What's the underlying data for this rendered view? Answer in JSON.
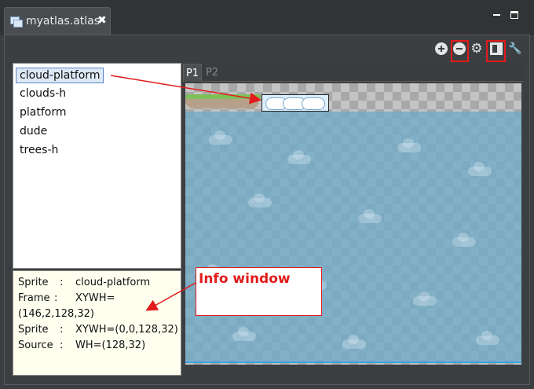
{
  "tab": {
    "title": "myatlas.atlas",
    "close_glyph": "✖",
    "icon": "atlas-file-icon"
  },
  "toolbar": {
    "icons": [
      "zoom-in-icon",
      "zoom-out-icon",
      "settings-gear-icon",
      "layout-toggle-icon",
      "wrench-icon"
    ]
  },
  "sprites": [
    "cloud-platform",
    "clouds-h",
    "platform",
    "dude",
    "trees-h"
  ],
  "selected_sprite": "cloud-platform",
  "info": [
    {
      "label": "Sprite",
      "value": "cloud-platform"
    },
    {
      "label": "Frame",
      "value": "XYWH="
    },
    {
      "label": "",
      "value": "(146,2,128,32)"
    },
    {
      "label": "Sprite",
      "value": "XYWH=(0,0,128,32)"
    },
    {
      "label": "Source",
      "value": "WH=(128,32)"
    }
  ],
  "pages": {
    "p1": "P1",
    "p2": "P2"
  },
  "annotation": {
    "info_label": "Info window"
  },
  "colors": {
    "highlight": "#e21b1b",
    "sky": "#6eaac8",
    "info_bg": "#fffff0"
  }
}
